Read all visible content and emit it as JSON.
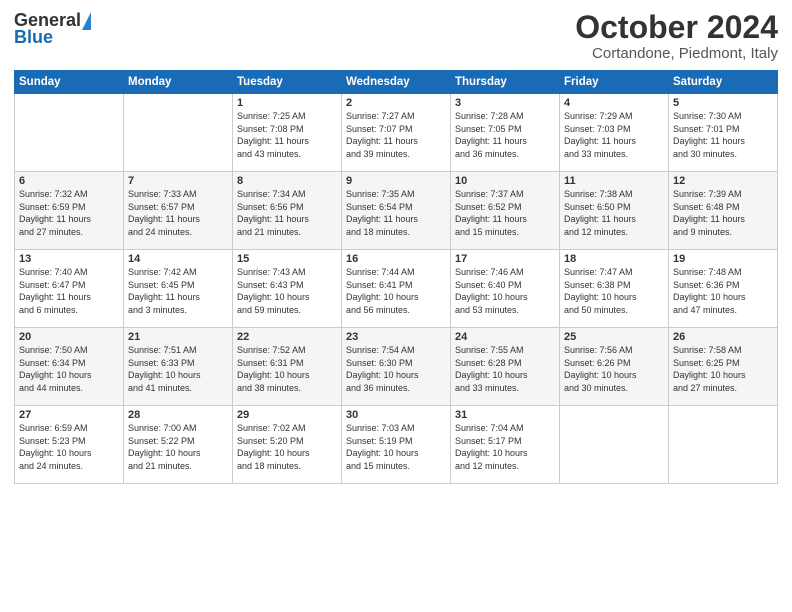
{
  "header": {
    "logo_general": "General",
    "logo_blue": "Blue",
    "month_title": "October 2024",
    "location": "Cortandone, Piedmont, Italy"
  },
  "days_of_week": [
    "Sunday",
    "Monday",
    "Tuesday",
    "Wednesday",
    "Thursday",
    "Friday",
    "Saturday"
  ],
  "weeks": [
    [
      {
        "day": "",
        "info": ""
      },
      {
        "day": "",
        "info": ""
      },
      {
        "day": "1",
        "info": "Sunrise: 7:25 AM\nSunset: 7:08 PM\nDaylight: 11 hours\nand 43 minutes."
      },
      {
        "day": "2",
        "info": "Sunrise: 7:27 AM\nSunset: 7:07 PM\nDaylight: 11 hours\nand 39 minutes."
      },
      {
        "day": "3",
        "info": "Sunrise: 7:28 AM\nSunset: 7:05 PM\nDaylight: 11 hours\nand 36 minutes."
      },
      {
        "day": "4",
        "info": "Sunrise: 7:29 AM\nSunset: 7:03 PM\nDaylight: 11 hours\nand 33 minutes."
      },
      {
        "day": "5",
        "info": "Sunrise: 7:30 AM\nSunset: 7:01 PM\nDaylight: 11 hours\nand 30 minutes."
      }
    ],
    [
      {
        "day": "6",
        "info": "Sunrise: 7:32 AM\nSunset: 6:59 PM\nDaylight: 11 hours\nand 27 minutes."
      },
      {
        "day": "7",
        "info": "Sunrise: 7:33 AM\nSunset: 6:57 PM\nDaylight: 11 hours\nand 24 minutes."
      },
      {
        "day": "8",
        "info": "Sunrise: 7:34 AM\nSunset: 6:56 PM\nDaylight: 11 hours\nand 21 minutes."
      },
      {
        "day": "9",
        "info": "Sunrise: 7:35 AM\nSunset: 6:54 PM\nDaylight: 11 hours\nand 18 minutes."
      },
      {
        "day": "10",
        "info": "Sunrise: 7:37 AM\nSunset: 6:52 PM\nDaylight: 11 hours\nand 15 minutes."
      },
      {
        "day": "11",
        "info": "Sunrise: 7:38 AM\nSunset: 6:50 PM\nDaylight: 11 hours\nand 12 minutes."
      },
      {
        "day": "12",
        "info": "Sunrise: 7:39 AM\nSunset: 6:48 PM\nDaylight: 11 hours\nand 9 minutes."
      }
    ],
    [
      {
        "day": "13",
        "info": "Sunrise: 7:40 AM\nSunset: 6:47 PM\nDaylight: 11 hours\nand 6 minutes."
      },
      {
        "day": "14",
        "info": "Sunrise: 7:42 AM\nSunset: 6:45 PM\nDaylight: 11 hours\nand 3 minutes."
      },
      {
        "day": "15",
        "info": "Sunrise: 7:43 AM\nSunset: 6:43 PM\nDaylight: 10 hours\nand 59 minutes."
      },
      {
        "day": "16",
        "info": "Sunrise: 7:44 AM\nSunset: 6:41 PM\nDaylight: 10 hours\nand 56 minutes."
      },
      {
        "day": "17",
        "info": "Sunrise: 7:46 AM\nSunset: 6:40 PM\nDaylight: 10 hours\nand 53 minutes."
      },
      {
        "day": "18",
        "info": "Sunrise: 7:47 AM\nSunset: 6:38 PM\nDaylight: 10 hours\nand 50 minutes."
      },
      {
        "day": "19",
        "info": "Sunrise: 7:48 AM\nSunset: 6:36 PM\nDaylight: 10 hours\nand 47 minutes."
      }
    ],
    [
      {
        "day": "20",
        "info": "Sunrise: 7:50 AM\nSunset: 6:34 PM\nDaylight: 10 hours\nand 44 minutes."
      },
      {
        "day": "21",
        "info": "Sunrise: 7:51 AM\nSunset: 6:33 PM\nDaylight: 10 hours\nand 41 minutes."
      },
      {
        "day": "22",
        "info": "Sunrise: 7:52 AM\nSunset: 6:31 PM\nDaylight: 10 hours\nand 38 minutes."
      },
      {
        "day": "23",
        "info": "Sunrise: 7:54 AM\nSunset: 6:30 PM\nDaylight: 10 hours\nand 36 minutes."
      },
      {
        "day": "24",
        "info": "Sunrise: 7:55 AM\nSunset: 6:28 PM\nDaylight: 10 hours\nand 33 minutes."
      },
      {
        "day": "25",
        "info": "Sunrise: 7:56 AM\nSunset: 6:26 PM\nDaylight: 10 hours\nand 30 minutes."
      },
      {
        "day": "26",
        "info": "Sunrise: 7:58 AM\nSunset: 6:25 PM\nDaylight: 10 hours\nand 27 minutes."
      }
    ],
    [
      {
        "day": "27",
        "info": "Sunrise: 6:59 AM\nSunset: 5:23 PM\nDaylight: 10 hours\nand 24 minutes."
      },
      {
        "day": "28",
        "info": "Sunrise: 7:00 AM\nSunset: 5:22 PM\nDaylight: 10 hours\nand 21 minutes."
      },
      {
        "day": "29",
        "info": "Sunrise: 7:02 AM\nSunset: 5:20 PM\nDaylight: 10 hours\nand 18 minutes."
      },
      {
        "day": "30",
        "info": "Sunrise: 7:03 AM\nSunset: 5:19 PM\nDaylight: 10 hours\nand 15 minutes."
      },
      {
        "day": "31",
        "info": "Sunrise: 7:04 AM\nSunset: 5:17 PM\nDaylight: 10 hours\nand 12 minutes."
      },
      {
        "day": "",
        "info": ""
      },
      {
        "day": "",
        "info": ""
      }
    ]
  ]
}
